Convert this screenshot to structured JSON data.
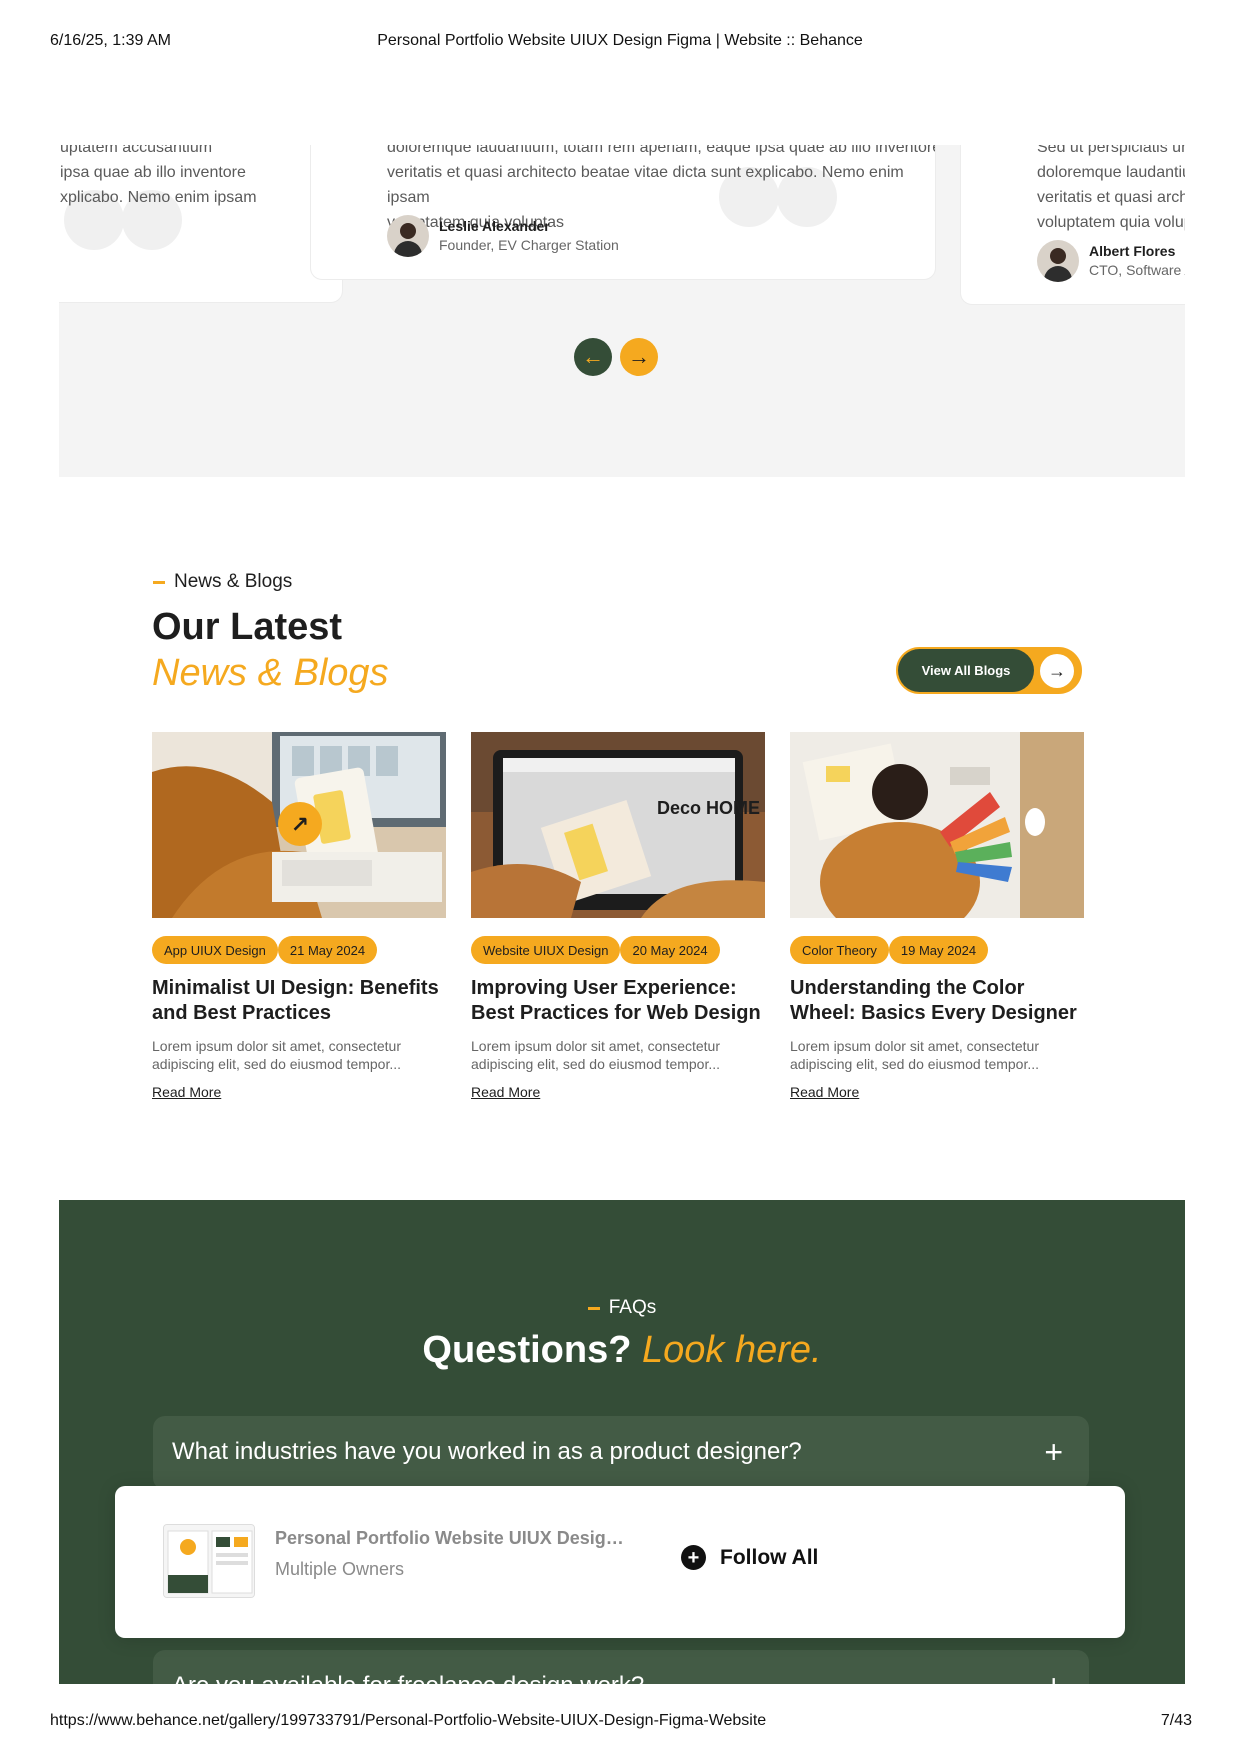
{
  "print_header": {
    "date": "6/16/25, 1:39 AM",
    "title": "Personal Portfolio Website UIUX Design Figma | Website :: Behance"
  },
  "print_footer": {
    "url": "https://www.behance.net/gallery/199733791/Personal-Portfolio-Website-UIUX-Design-Figma-Website",
    "page": "7/43"
  },
  "testimonials": [
    {
      "text": "uptatem accusantium\nipsa quae ab illo inventore\nxplicabo. Nemo enim ipsam"
    },
    {
      "text": "doloremque laudantium, totam rem aperiam, eaque ipsa quae ab illo inventore\nveritatis et quasi architecto beatae vitae dicta sunt explicabo. Nemo enim ipsam\nvoluptatem quia voluptas",
      "name": "Leslie Alexander",
      "role": "Founder, EV Charger Station"
    },
    {
      "text": "Sed ut perspiciatis unde om\ndoloremque laudantium, tot\nveritatis et quasi architecto b\nvoluptatem quia voluptas",
      "name": "Albert Flores",
      "role": "CTO, Software Agency"
    }
  ],
  "testimonial_nav": {
    "prev_icon": "arrow-left-icon",
    "next_icon": "arrow-right-icon",
    "prev": "←",
    "next": "→"
  },
  "blogs": {
    "eyebrow": "News & Blogs",
    "heading_line1": "Our Latest",
    "heading_line2": "News & Blogs",
    "view_all": "View All Blogs",
    "view_all_arrow": "→",
    "items": [
      {
        "category": "App UIUX Design",
        "date": "21 May 2024",
        "title1": "Minimalist UI Design: Benefits",
        "title2": "and Best Practices",
        "ex1": "Lorem ipsum dolor sit amet, consectetur",
        "ex2": "adipiscing elit, sed do eiusmod tempor...",
        "read_more": "Read More"
      },
      {
        "category": "Website UIUX Design",
        "date": "20 May 2024",
        "title1": "Improving User Experience:",
        "title2": "Best Practices for Web Design",
        "ex1": "Lorem ipsum dolor sit amet, consectetur",
        "ex2": "adipiscing elit, sed do eiusmod tempor...",
        "read_more": "Read More",
        "screen_text": "Deco HOME"
      },
      {
        "category": "Color Theory",
        "date": "19 May 2024",
        "title1": "Understanding the Color",
        "title2": "Wheel: Basics Every Designer",
        "ex1": "Lorem ipsum dolor sit amet, consectetur",
        "ex2": "adipiscing elit, sed do eiusmod tempor...",
        "read_more": "Read More"
      }
    ]
  },
  "faq": {
    "eyebrow": "FAQs",
    "heading_white": "Questions?",
    "heading_yellow": "Look here.",
    "items": [
      {
        "question": "What industries have you worked in as a product designer?",
        "icon": "+"
      },
      {
        "question": "Are you available for freelance design work?",
        "icon": "+"
      }
    ]
  },
  "follow_bar": {
    "project_title": "Personal Portfolio Website UIUX Design Figma | Website",
    "owners": "Multiple Owners",
    "follow_label": "Follow All",
    "follow_icon": "+"
  },
  "colors": {
    "accent": "#f5a91f",
    "dark_green": "#344d37",
    "faq_item": "#435b45"
  }
}
